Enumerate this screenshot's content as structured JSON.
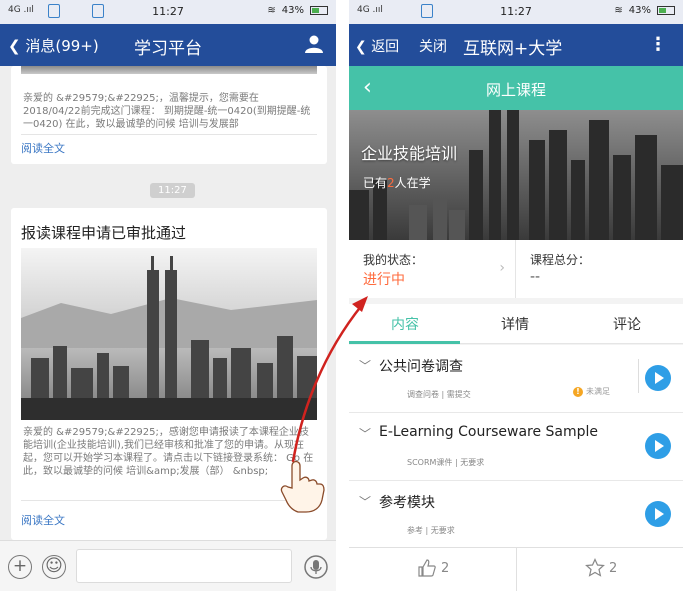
{
  "left": {
    "statusbar": {
      "network": "4G .ııl",
      "time": "11:27",
      "battery": "43%"
    },
    "navbar": {
      "back_label": "消息(99+)",
      "title": "学习平台"
    },
    "card_top": {
      "text": "亲爱的 &#29579;&#22925;，温馨提示，您需要在2018/04/22前完成这门课程： 到期提醒-统一0420(到期提醒-统一0420) 在此，致以最诚挚的问候 培训与发展部",
      "read_more": "阅读全文"
    },
    "time_chip": "11:27",
    "card_main": {
      "title": "报读课程申请已审批通过",
      "body": "亲爱的 &#29579;&#22925;，感谢您申请报读了本课程企业技能培训(企业技能培训),我们已经审核和批准了您的申请。从现在起，您可以开始学习本课程了。请点击以下链接登录系统： Go 在此，致以最诚挚的问候 培训&amp;发展（部） &nbsp;",
      "read_more": "阅读全文"
    },
    "bottom_bar": {
      "add": "+",
      "emoji": "☺"
    }
  },
  "right": {
    "statusbar": {
      "network": "4G .ııl",
      "time": "11:27",
      "battery": "43%"
    },
    "navbar": {
      "back_label": "返回",
      "close_label": "关闭",
      "title": "互联网+大学",
      "more": "⋮"
    },
    "header": {
      "title": "网上课程"
    },
    "hero": {
      "course_title": "企业技能培训",
      "learners_prefix": "已有",
      "learners_count": "2",
      "learners_suffix": "人在学"
    },
    "stats": {
      "status_label": "我的状态：",
      "status_value": "进行中",
      "total_label": "课程总分：",
      "total_value": "--"
    },
    "tabs": [
      "内容",
      "详情",
      "评论"
    ],
    "modules": [
      {
        "title": "公共问卷调查",
        "meta": "调查问卷 | 需提交",
        "warn": "未满足"
      },
      {
        "title": "E-Learning Courseware Sample",
        "meta": "SCORM课件 | 无要求"
      },
      {
        "title": "参考模块",
        "meta": "参考 | 无要求"
      }
    ],
    "actions": {
      "likes": "2",
      "favorites": "2"
    }
  },
  "colors": {
    "nav_blue": "#234d9a",
    "teal": "#45c2a8",
    "play_blue": "#2e9ee6",
    "status_orange": "#ff6b3d",
    "arrow_red": "#d0231f"
  }
}
